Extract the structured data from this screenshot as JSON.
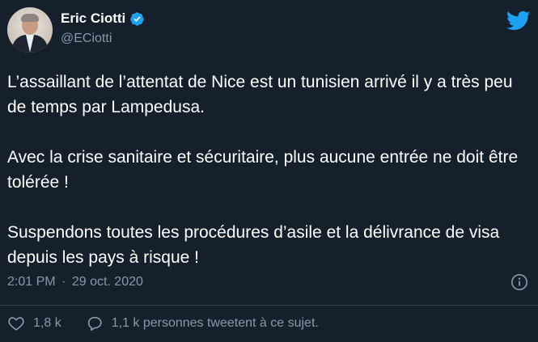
{
  "user": {
    "name": "Eric Ciotti",
    "handle": "@ECiotti",
    "verified": true
  },
  "tweet": {
    "paragraphs": [
      "L’assaillant de l’attentat de Nice est un tunisien arrivé il y a très peu de temps par Lampedusa.",
      "Avec la crise sanitaire et sécuritaire, plus aucune entrée ne doit être tolérée !",
      "Suspendons toutes les procédures d’asile et la délivrance de visa depuis les pays à risque !"
    ],
    "time": "2:01 PM",
    "separator": "·",
    "date": "29 oct. 2020"
  },
  "actions": {
    "likes": "1,8 k",
    "replies_text": "1,1 k personnes tweetent à ce sujet."
  },
  "colors": {
    "background": "#15202b",
    "text": "#ffffff",
    "secondary": "#8899a6",
    "accent": "#1da1f2",
    "divider": "#38444d"
  },
  "icons": [
    "verified-badge-icon",
    "twitter-bird-icon",
    "info-icon",
    "heart-icon",
    "speech-bubble-icon"
  ]
}
